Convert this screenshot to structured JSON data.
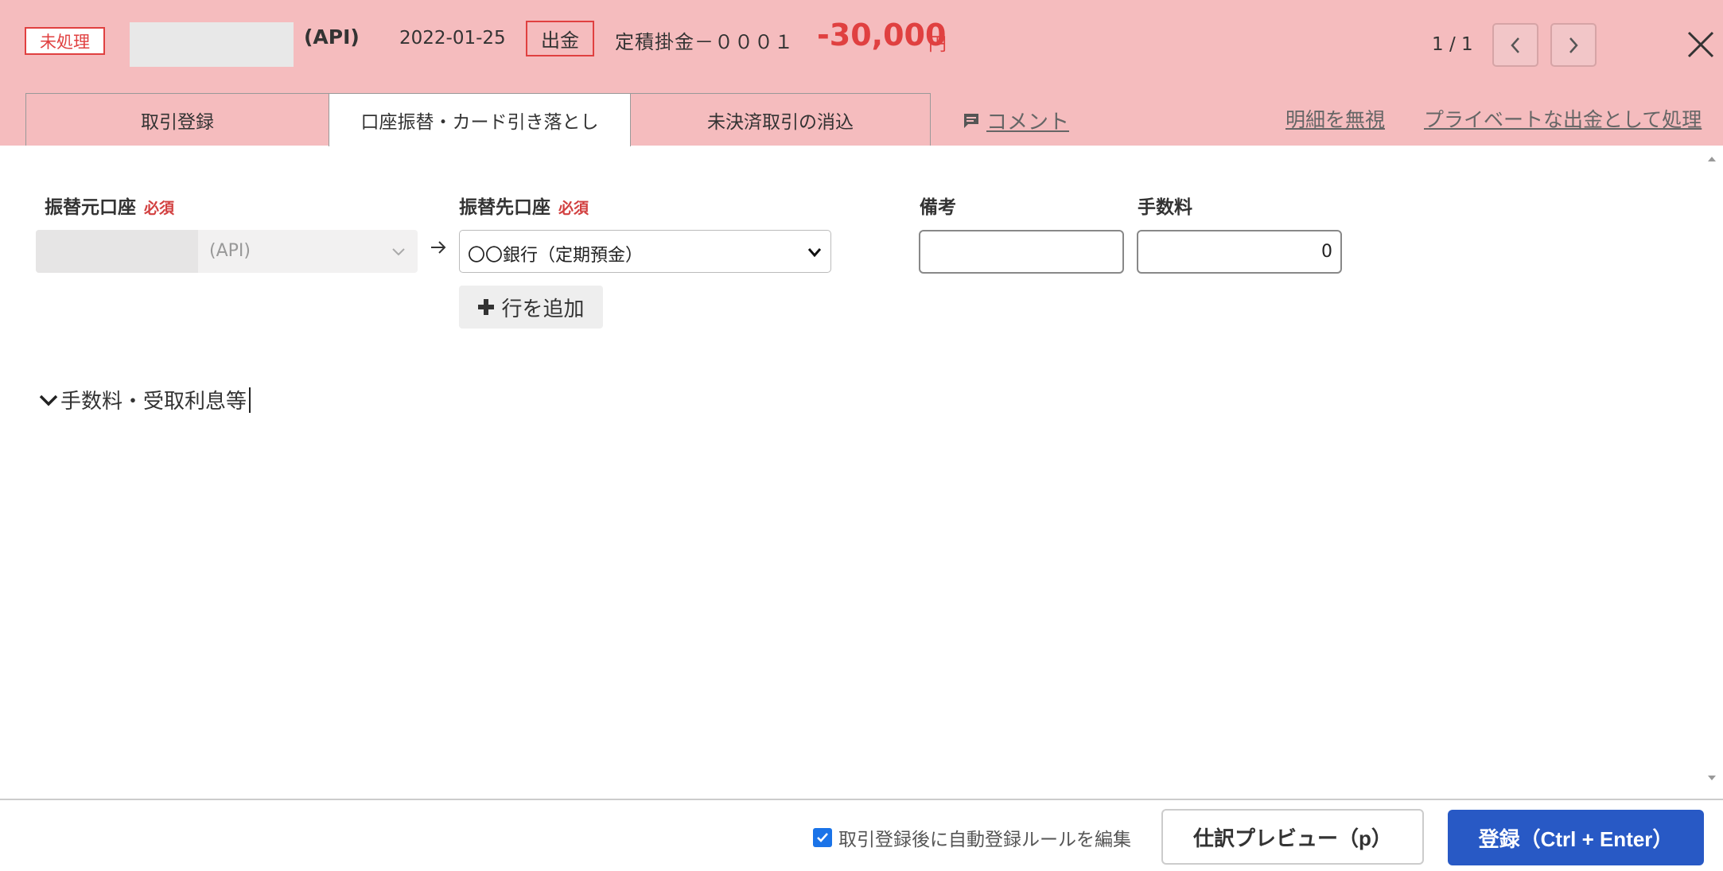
{
  "header": {
    "status_badge": "未処理",
    "account_suffix": "(API)",
    "date": "2022-01-25",
    "type_badge": "出金",
    "description": "定積掛金－０００１",
    "amount": "-30,000",
    "currency": "円",
    "pager": "1 / 1"
  },
  "tabs": [
    {
      "label": "取引登録"
    },
    {
      "label": "口座振替・カード引き落とし",
      "active": true
    },
    {
      "label": "未決済取引の消込"
    }
  ],
  "links": {
    "comment": "コメント",
    "ignore": "明細を無視",
    "private": "プライベートな出金として処理"
  },
  "form": {
    "from_label": "振替元口座",
    "to_label": "振替先口座",
    "required": "必須",
    "memo_label": "備考",
    "fee_label": "手数料",
    "from_value": "(API)",
    "to_value": "〇〇銀行（定期預金）",
    "memo_value": "",
    "fee_value": "0",
    "add_row": "行を追加",
    "fee_section": "手数料・受取利息等"
  },
  "footer": {
    "auto_rule": "取引登録後に自動登録ルールを編集",
    "auto_rule_checked": true,
    "preview": "仕訳プレビュー（p）",
    "register": "登録（Ctrl + Enter）"
  },
  "icons": {
    "prev": "chevron-left-icon",
    "next": "chevron-right-icon",
    "close": "close-icon",
    "comment": "comment-icon",
    "arrow": "arrow-right-icon",
    "plus": "plus-icon",
    "fee_toggle": "chevron-down-icon"
  },
  "colors": {
    "header_bg": "#f5bcbe",
    "accent_red": "#e04040",
    "primary_blue": "#2859c5"
  }
}
